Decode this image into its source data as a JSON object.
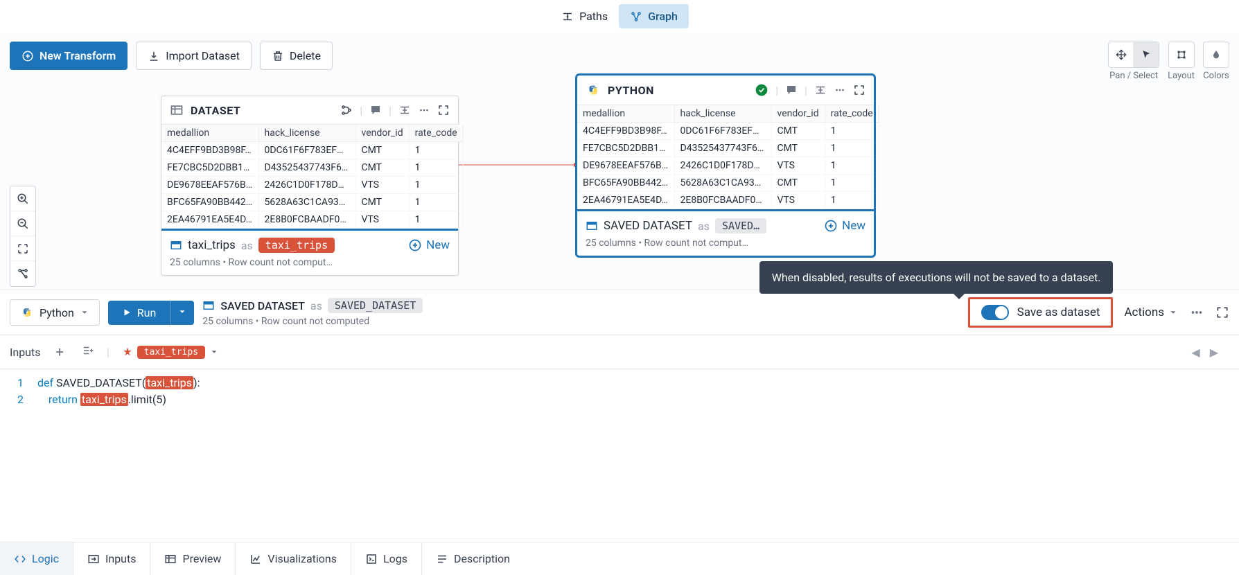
{
  "top_tabs": {
    "paths": "Paths",
    "graph": "Graph"
  },
  "toolbar": {
    "new_transform": "New Transform",
    "import": "Import Dataset",
    "delete": "Delete"
  },
  "right_tools": {
    "pan_select": "Pan / Select",
    "layout": "Layout",
    "colors": "Colors"
  },
  "node_dataset": {
    "title": "DATASET",
    "columns": [
      "medallion",
      "hack_license",
      "vendor_id",
      "rate_code"
    ],
    "rows": [
      [
        "4C4EFF9BD3B98F…",
        "0DC61F6F783EFC…",
        "CMT",
        "1"
      ],
      [
        "FE7CBC5D2DBB1E…",
        "D43525437743F62…",
        "CMT",
        "1"
      ],
      [
        "DE9678EEAF576B…",
        "2426C1D0F178DD…",
        "VTS",
        "1"
      ],
      [
        "BFC65FA90BB442…",
        "5628A63C1CA937…",
        "CMT",
        "1"
      ],
      [
        "2EA46791EA5E4D…",
        "2E8B0FCBAADF05…",
        "VTS",
        "1"
      ]
    ],
    "footer_name": "taxi_trips",
    "footer_as": "as",
    "footer_chip": "taxi_trips",
    "new": "New",
    "meta": "25 columns   •   Row count not comput…"
  },
  "node_python": {
    "title": "PYTHON",
    "columns": [
      "medallion",
      "hack_license",
      "vendor_id",
      "rate_code"
    ],
    "rows": [
      [
        "4C4EFF9BD3B98F…",
        "0DC61F6F783EFC…",
        "CMT",
        "1"
      ],
      [
        "FE7CBC5D2DBB1E…",
        "D43525437743F62…",
        "CMT",
        "1"
      ],
      [
        "DE9678EEAF576B…",
        "2426C1D0F178DD…",
        "VTS",
        "1"
      ],
      [
        "BFC65FA90BB442…",
        "5628A63C1CA937…",
        "CMT",
        "1"
      ],
      [
        "2EA46791EA5E4D…",
        "2E8B0FCBAADF05…",
        "VTS",
        "1"
      ]
    ],
    "footer_title": "SAVED DATASET",
    "footer_as": "as",
    "footer_chip": "SAVED…",
    "new": "New",
    "meta": "25 columns   •   Row count not comput…"
  },
  "mid": {
    "lang": "Python",
    "run": "Run",
    "saved_label": "SAVED DATASET",
    "as": "as",
    "saved_chip": "SAVED_DATASET",
    "meta": "25 columns   •   Row count not computed",
    "save_as": "Save as dataset",
    "actions": "Actions",
    "tooltip": "When disabled, results of executions will not be saved to a dataset."
  },
  "inputs": {
    "label": "Inputs",
    "chip": "taxi_trips"
  },
  "code": {
    "l1a": "def ",
    "l1b": "SAVED_DATASET(",
    "l1c": "taxi_trips",
    "l1d": "):",
    "l2a": "return ",
    "l2b": "taxi_trips",
    "l2c": ".limit(5)"
  },
  "bottom": {
    "logic": "Logic",
    "inputs": "Inputs",
    "preview": "Preview",
    "viz": "Visualizations",
    "logs": "Logs",
    "desc": "Description"
  }
}
